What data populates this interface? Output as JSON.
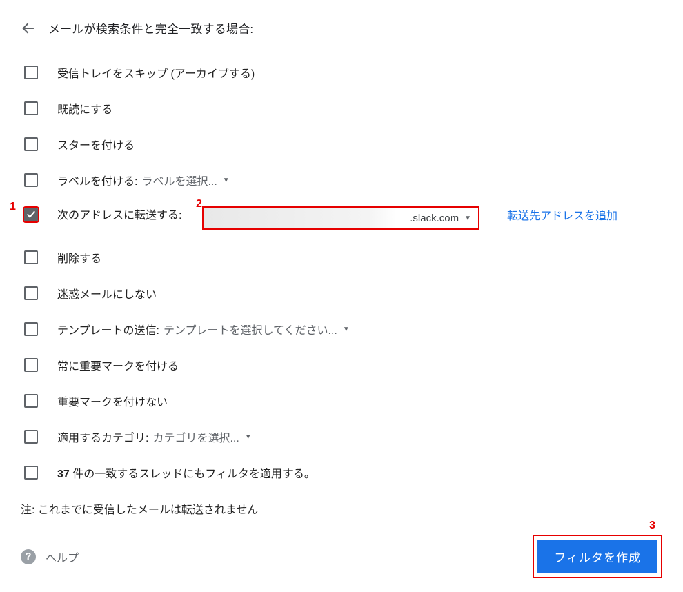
{
  "header": {
    "title": "メールが検索条件と完全一致する場合:"
  },
  "options": {
    "skip_inbox": "受信トレイをスキップ (アーカイブする)",
    "mark_read": "既読にする",
    "star": "スターを付ける",
    "apply_label": "ラベルを付ける:",
    "label_select": "ラベルを選択...",
    "forward_to": "次のアドレスに転送する:",
    "forward_value": ".slack.com",
    "add_forward": "転送先アドレスを追加",
    "delete": "削除する",
    "never_spam": "迷惑メールにしない",
    "send_template": "テンプレートの送信:",
    "template_select": "テンプレートを選択してください...",
    "always_important": "常に重要マークを付ける",
    "never_important": "重要マークを付けない",
    "apply_category": "適用するカテゴリ:",
    "category_select": "カテゴリを選択...",
    "also_apply_count": "37",
    "also_apply_text": " 件の一致するスレッドにもフィルタを適用する。"
  },
  "note": "注: これまでに受信したメールは転送されません",
  "footer": {
    "help": "ヘルプ",
    "create": "フィルタを作成"
  },
  "annotations": {
    "a1": "1",
    "a2": "2",
    "a3": "3"
  }
}
